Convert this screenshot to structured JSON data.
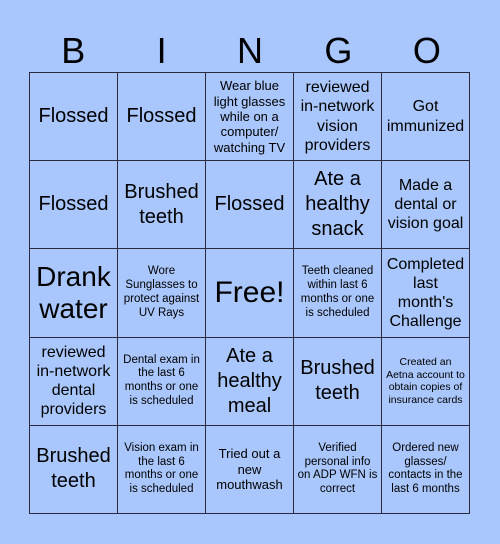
{
  "header": {
    "letters": [
      "B",
      "I",
      "N",
      "G",
      "O"
    ]
  },
  "card": {
    "background_color": "#a9c7fc",
    "grid_line_color": "#2a2a40",
    "rows": [
      [
        "Flossed",
        "Flossed",
        "Wear blue light glasses while on a computer/ watching TV",
        "reviewed in-network vision providers",
        "Got immunized"
      ],
      [
        "Flossed",
        "Brushed teeth",
        "Flossed",
        "Ate a healthy snack",
        "Made a dental or vision goal"
      ],
      [
        "Drank water",
        "Wore Sunglasses to protect against UV Rays",
        "Free!",
        "Teeth cleaned within last 6 months or one is scheduled",
        "Completed last month's Challenge"
      ],
      [
        "reviewed in-network dental providers",
        "Dental exam in the last 6 months or one is scheduled",
        "Ate a healthy meal",
        "Brushed teeth",
        "Created an Aetna account to obtain copies of insurance cards"
      ],
      [
        "Brushed teeth",
        "Vision exam in the last 6 months or one is scheduled",
        "Tried out a new mouthwash",
        "Verified personal info on ADP WFN is correct",
        "Ordered new glasses/ contacts in the last 6 months"
      ]
    ]
  }
}
